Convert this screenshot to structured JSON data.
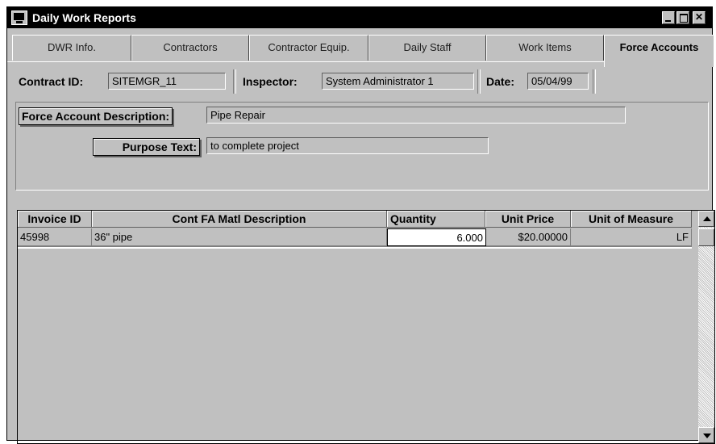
{
  "window": {
    "title": "Daily Work Reports"
  },
  "tabs": [
    "DWR Info.",
    "Contractors",
    "Contractor Equip.",
    "Daily Staff",
    "Work Items",
    "Force Accounts"
  ],
  "active_tab": "Force Accounts",
  "header": {
    "contract_label": "Contract ID:",
    "contract_value": "SITEMGR_11",
    "inspector_label": "Inspector:",
    "inspector_value": "System Administrator 1",
    "date_label": "Date:",
    "date_value": "05/04/99"
  },
  "force_account": {
    "description_label": "Force Account Description:",
    "description_value": "Pipe Repair",
    "purpose_label": "Purpose Text:",
    "purpose_value": "to complete project"
  },
  "table": {
    "columns": [
      "Invoice ID",
      "Cont FA Matl Description",
      "Quantity",
      "Unit Price",
      "Unit of Measure"
    ],
    "rows": [
      [
        "45998",
        "36\" pipe",
        "6.000",
        "$20.00000",
        "LF"
      ]
    ]
  }
}
